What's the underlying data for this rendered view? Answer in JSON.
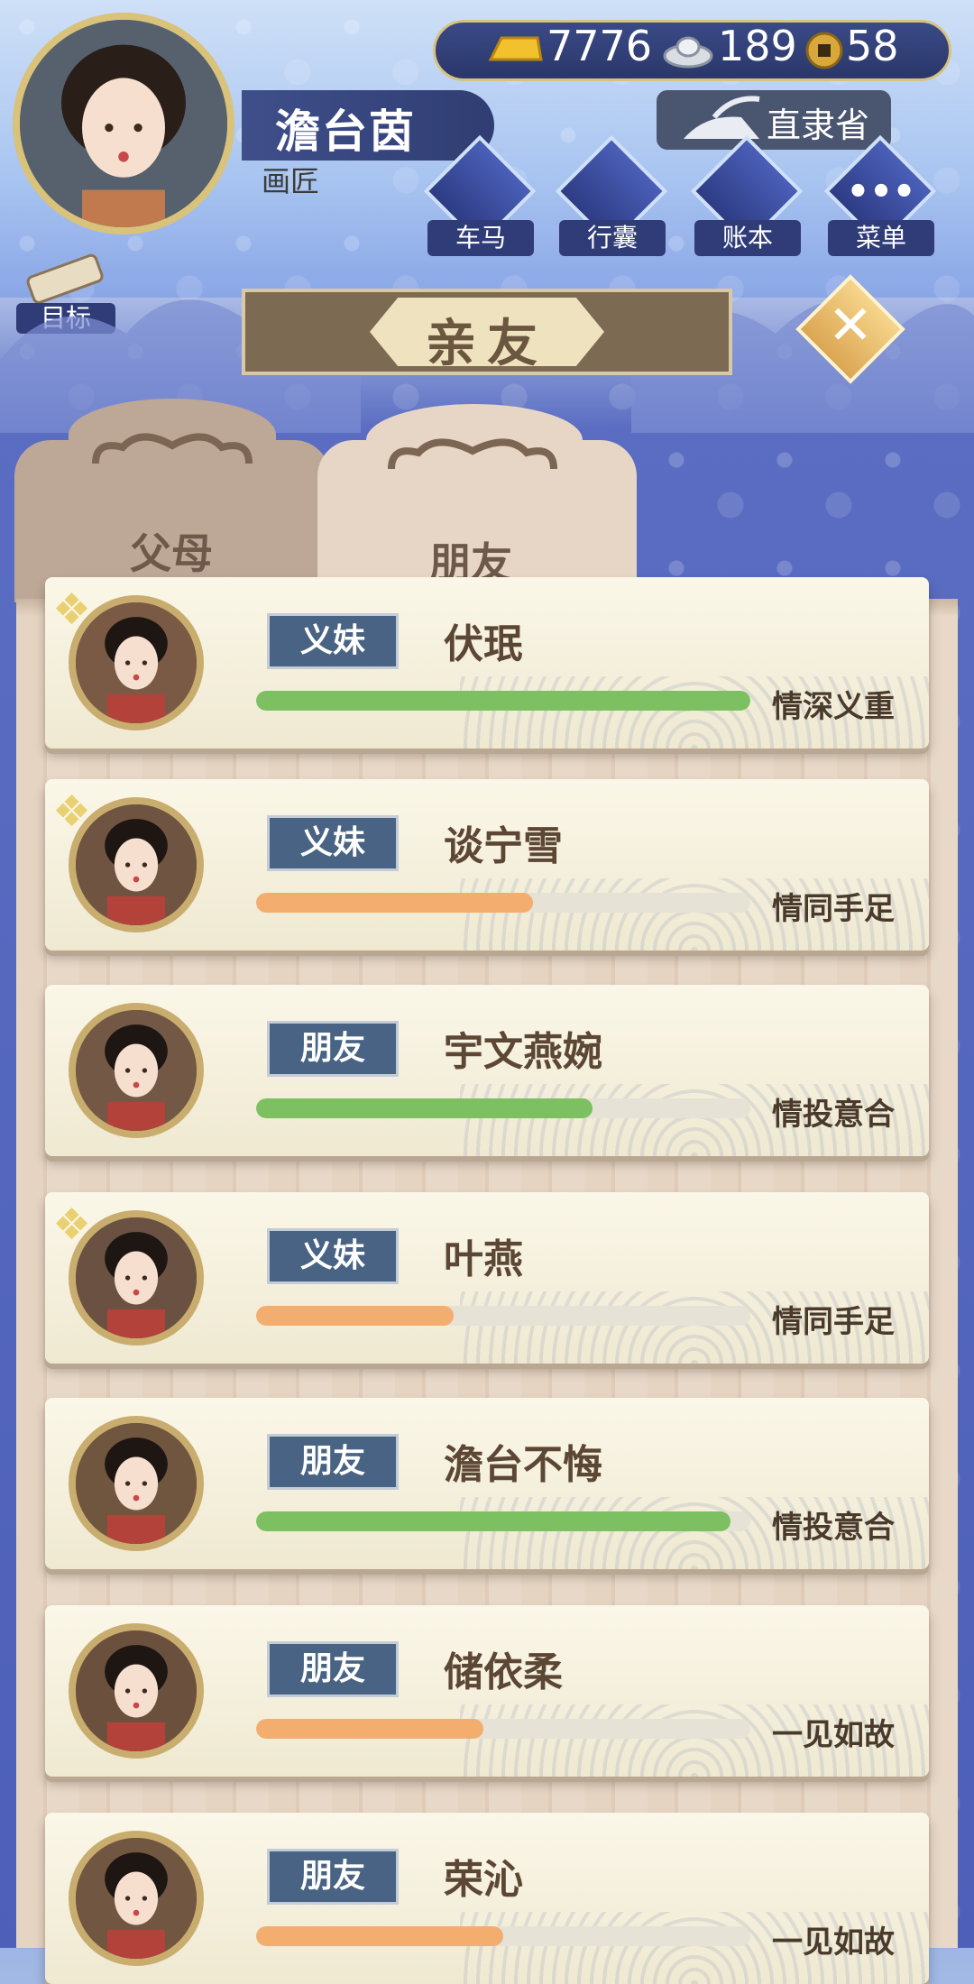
{
  "player": {
    "name": "澹台茵",
    "title": "画匠",
    "location": "直隶省"
  },
  "currency": {
    "gold": "7776",
    "silver": "189",
    "coins": "58"
  },
  "menu": [
    {
      "label": "车马"
    },
    {
      "label": "行囊"
    },
    {
      "label": "账本"
    },
    {
      "label": "菜单"
    }
  ],
  "goal_label": "目标",
  "page_title": "亲友",
  "tabs": [
    {
      "label": "父母"
    },
    {
      "label": "朋友"
    }
  ],
  "friends": [
    {
      "tag": "义妹",
      "name": "伏珉",
      "status": "情深义重",
      "bond": 1.0,
      "bar_color": "#7cc061",
      "knot": true
    },
    {
      "tag": "义妹",
      "name": "谈宁雪",
      "status": "情同手足",
      "bond": 0.56,
      "bar_color": "#f3ad6e",
      "knot": true
    },
    {
      "tag": "朋友",
      "name": "宇文燕婉",
      "status": "情投意合",
      "bond": 0.68,
      "bar_color": "#7cc061",
      "knot": false
    },
    {
      "tag": "义妹",
      "name": "叶燕",
      "status": "情同手足",
      "bond": 0.4,
      "bar_color": "#f3ad6e",
      "knot": true
    },
    {
      "tag": "朋友",
      "name": "澹台不悔",
      "status": "情投意合",
      "bond": 0.96,
      "bar_color": "#7cc061",
      "knot": false
    },
    {
      "tag": "朋友",
      "name": "储依柔",
      "status": "一见如故",
      "bond": 0.46,
      "bar_color": "#f3ad6e",
      "knot": false
    },
    {
      "tag": "朋友",
      "name": "荣沁",
      "status": "一见如故",
      "bond": 0.5,
      "bar_color": "#f3ad6e",
      "knot": false
    }
  ]
}
